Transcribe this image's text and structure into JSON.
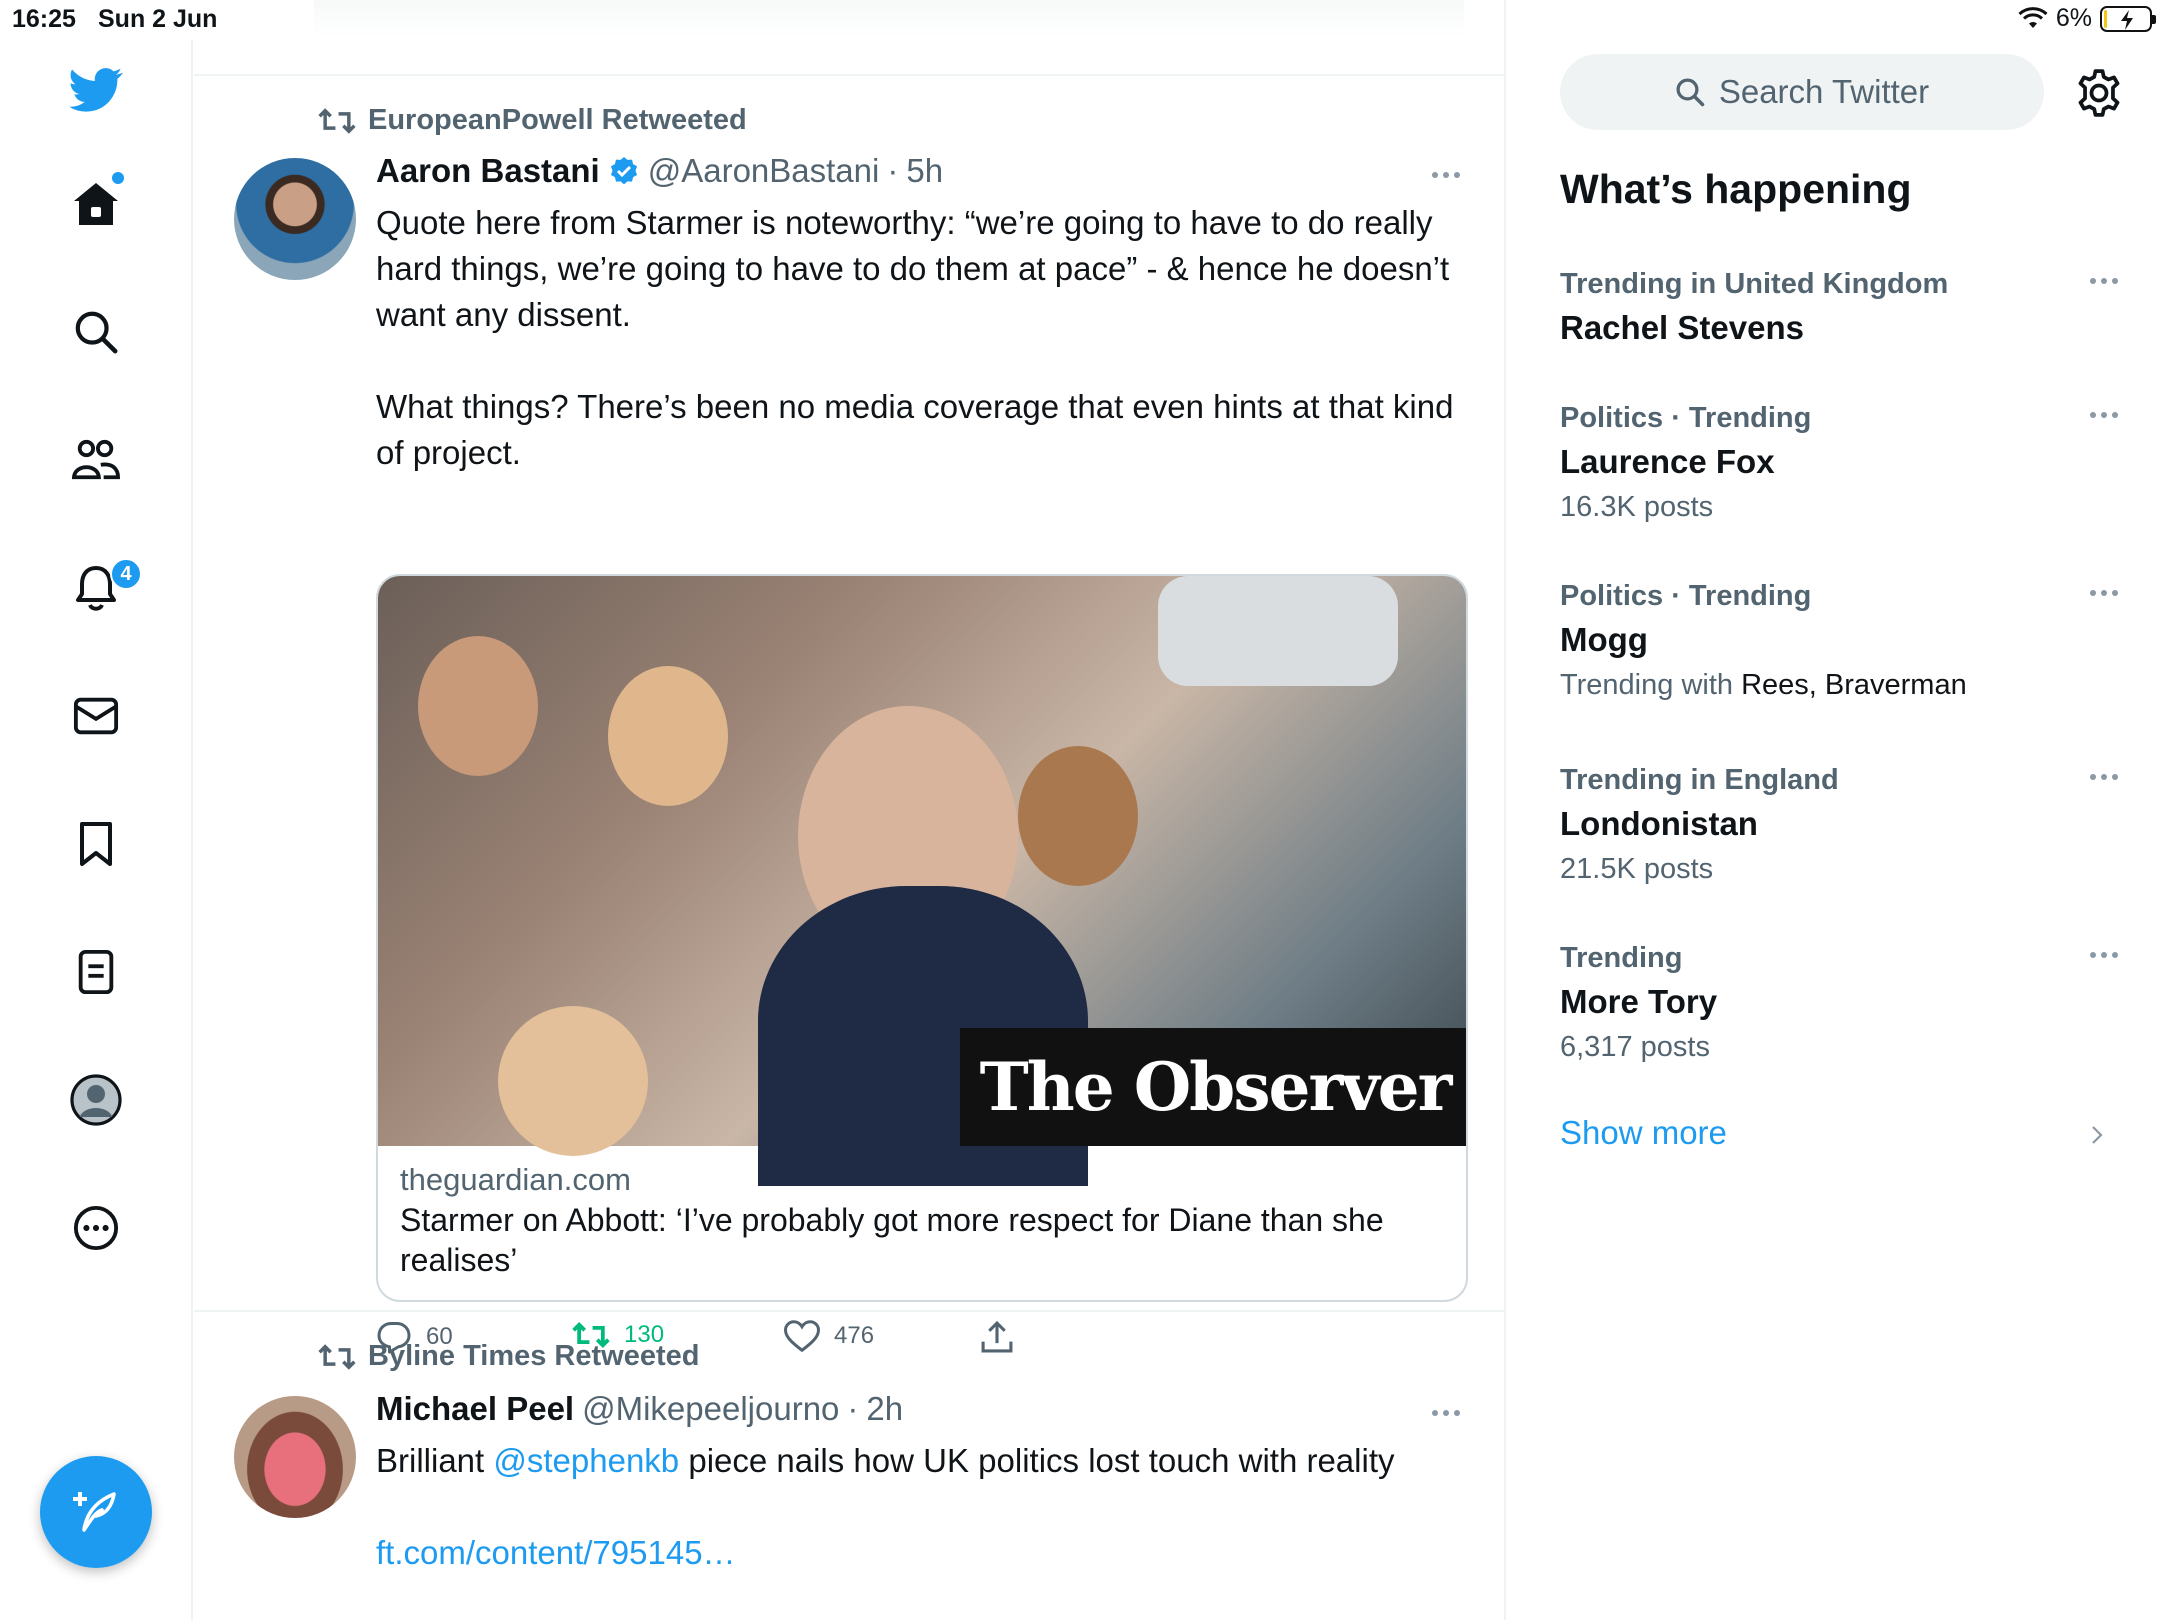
{
  "status_bar": {
    "time": "16:25",
    "date": "Sun 2 Jun",
    "battery": "6%",
    "battery_level": 0.06
  },
  "nav": {
    "items": [
      {
        "icon": "twitter-logo-icon"
      },
      {
        "icon": "home-icon"
      },
      {
        "icon": "search-icon"
      },
      {
        "icon": "communities-icon"
      },
      {
        "icon": "notifications-icon",
        "badge": "4"
      },
      {
        "icon": "messages-icon"
      },
      {
        "icon": "bookmarks-icon"
      },
      {
        "icon": "lists-icon"
      },
      {
        "icon": "profile-icon"
      },
      {
        "icon": "more-icon"
      }
    ],
    "compose_icon": "compose-tweet-icon"
  },
  "tweets": [
    {
      "retweeted_by": "EuropeanPowell Retweeted",
      "name": "Aaron Bastani",
      "verified": true,
      "handle": "@AaronBastani",
      "time": "5h",
      "text_1": "Quote here from Starmer is noteworthy: “we’re going to have to do really hard things, we’re going to have to do them at pace” - & hence he doesn’t want any dissent.",
      "text_2": "What things? There’s been no media coverage that even hints at that kind of project.",
      "card": {
        "image_caption": "The Observer",
        "domain": "theguardian.com",
        "title": "Starmer on Abbott: ‘I’ve probably got more respect for Diane than she realises’"
      },
      "replies": "60",
      "retweets": "130",
      "likes": "476",
      "retweeted": true
    },
    {
      "retweeted_by": "Byline Times Retweeted",
      "name": "Michael Peel",
      "handle": "@Mikepeeljourno",
      "time": "2h",
      "text_pre": "Brilliant ",
      "mention": "@stephenkb",
      "text_post": " piece nails how UK politics lost touch with reality",
      "link": "ft.com/content/795145…"
    }
  ],
  "sidebar": {
    "search_placeholder": "Search Twitter",
    "title": "What’s happening",
    "trends": [
      {
        "context": "Trending in United Kingdom",
        "name": "Rachel Stevens"
      },
      {
        "context": "Politics · Trending",
        "name": "Laurence Fox",
        "meta": "16.3K posts"
      },
      {
        "context": "Politics · Trending",
        "name": "Mogg",
        "meta_prefix": "Trending with ",
        "meta_names": "Rees, Braverman"
      },
      {
        "context": "Trending in England",
        "name": "Londonistan",
        "meta": "21.5K posts"
      },
      {
        "context": "Trending",
        "name": "More Tory",
        "meta": "6,317 posts"
      }
    ],
    "show_more": "Show more"
  },
  "colors": {
    "accent": "#1d9bf0",
    "retweet": "#00ba7c",
    "secondary_text": "#536471"
  }
}
